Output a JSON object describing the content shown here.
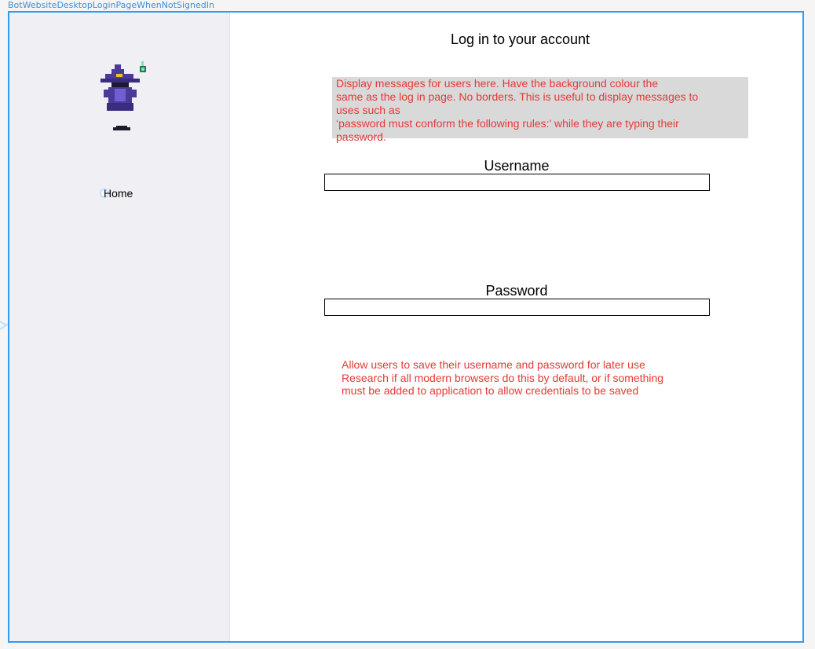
{
  "frame": {
    "label": "BotWebsiteDesktopLoginPageWhenNotSignedIn"
  },
  "sidebar": {
    "logo_icon": "wizard-icon",
    "nav_home": "Home"
  },
  "main": {
    "title": "Log in to your account",
    "message_box": [
      "Display messages for users here. Have the background colour the",
      "same as the log in page. No borders. This is useful to display messages to",
      "uses such as",
      "‘password must conform the following rules:’ while they are typing their",
      "password."
    ],
    "username": {
      "label": "Username",
      "value": ""
    },
    "password": {
      "label": "Password",
      "value": ""
    },
    "note": [
      "Allow users to save their username and password for later use",
      "Research if all modern browsers do this by default, or if something",
      "must be added to application to allow credentials to be saved"
    ]
  },
  "colors": {
    "frame_border": "#2f9bf3",
    "sidebar_bg": "#efeff4",
    "message_bg": "#d9d9d9",
    "annotation_text": "#e53935",
    "wizard_purple": "#4b3a9c"
  }
}
